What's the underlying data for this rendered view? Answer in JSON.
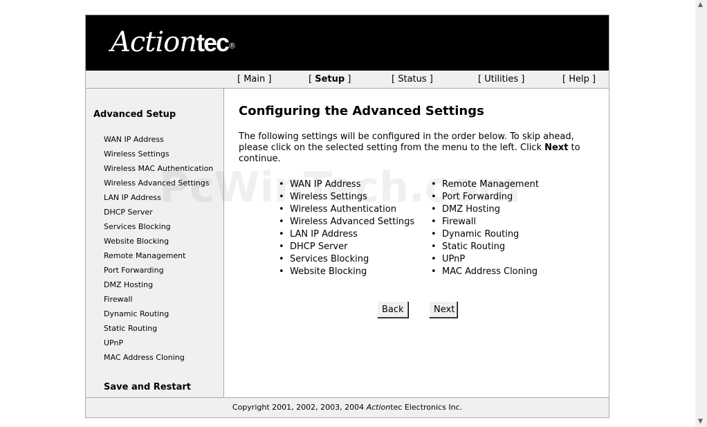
{
  "brand": {
    "logo_main": "Action",
    "logo_tec": "tec",
    "logo_reg": "®"
  },
  "nav": [
    {
      "open": "[ ",
      "label": "Main",
      "close": " ]"
    },
    {
      "open": "[ ",
      "label": "Setup",
      "close": " ]",
      "active": true
    },
    {
      "open": "[ ",
      "label": "Status",
      "close": " ]"
    },
    {
      "open": "[ ",
      "label": "Utilities",
      "close": " ]"
    },
    {
      "open": "[ ",
      "label": "Help",
      "close": " ]"
    }
  ],
  "sidebar": {
    "title": "Advanced Setup",
    "items": [
      "WAN IP Address",
      "Wireless Settings",
      "Wireless MAC Authentication",
      "Wireless Advanced Settings",
      "LAN IP Address",
      "DHCP Server",
      "Services Blocking",
      "Website Blocking",
      "Remote Management",
      "Port Forwarding",
      "DMZ Hosting",
      "Firewall",
      "Dynamic Routing",
      "Static Routing",
      "UPnP",
      "MAC Address Cloning"
    ],
    "save_restart": "Save and Restart"
  },
  "main": {
    "title": "Configuring the Advanced Settings",
    "intro_part1": "The following settings will be configured in the order below. To skip ahead, please click on the selected setting from the menu to the left. Click ",
    "intro_bold": "Next",
    "intro_part2": " to continue.",
    "list_left": [
      "WAN IP Address",
      "Wireless Settings",
      "Wireless Authentication",
      "Wireless Advanced Settings",
      "LAN IP Address",
      "DHCP Server",
      "Services Blocking",
      "Website Blocking"
    ],
    "list_right": [
      "Remote Management",
      "Port Forwarding",
      "DMZ Hosting",
      "Firewall",
      "Dynamic Routing",
      "Static Routing",
      "UPnP",
      "MAC Address Cloning"
    ],
    "back_label": "Back",
    "next_label": "Next"
  },
  "footer": {
    "prefix": "Copyright 2001, 2002, 2003, 2004 ",
    "brand_italic": "Action",
    "brand_rest": "tec",
    "suffix": " Electronics Inc."
  },
  "watermark": "PcWinTech.com",
  "scrollbar": {
    "up_icon": "up-arrow-icon",
    "down_icon": "down-arrow-icon"
  }
}
